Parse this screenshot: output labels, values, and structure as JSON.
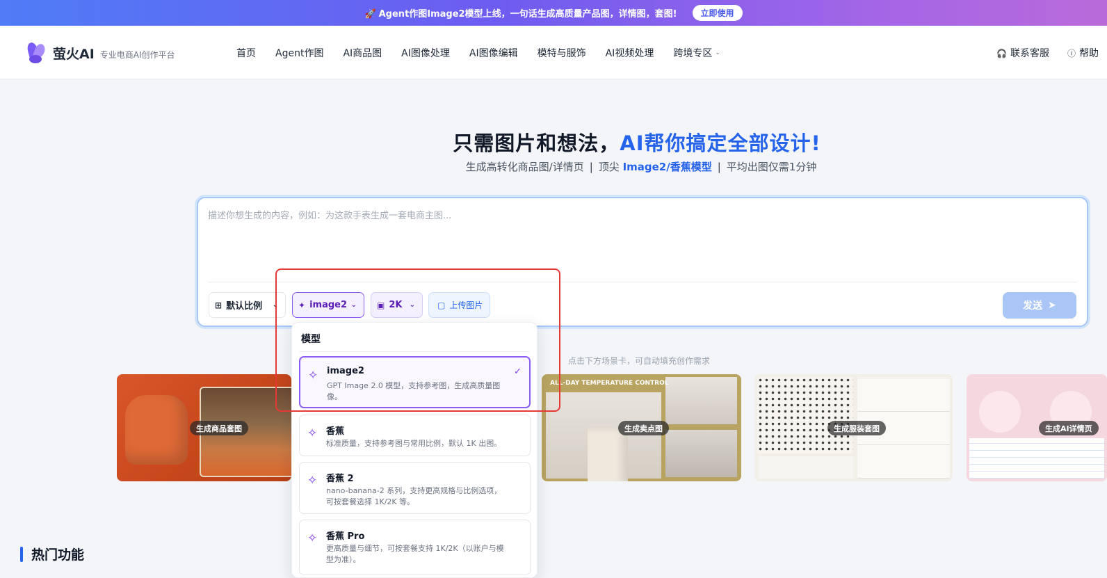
{
  "banner": {
    "icon": "rocket-icon",
    "text": "Agent作图Image2模型上线，一句话生成高质量产品图，详情图，套图!",
    "button": "立即使用"
  },
  "header": {
    "brand": "萤火AI",
    "brand_sub": "专业电商AI创作平台",
    "nav": [
      "首页",
      "Agent作图",
      "AI商品图",
      "AI图像处理",
      "AI图像编辑",
      "模特与服饰",
      "AI视频处理",
      "跨境专区"
    ],
    "support": "联系客服",
    "help": "帮助"
  },
  "hero": {
    "title_main": "只需图片和想法，",
    "title_accent": "AI帮你搞定全部设计!",
    "sub_part1": "生成高转化商品图/详情页",
    "sub_part2": "顶尖",
    "sub_accent": "Image2/香蕉模型",
    "sub_part3": "平均出图仅需1分钟",
    "separator": "|"
  },
  "prompt": {
    "placeholder": "描述你想生成的内容，例如：为这款手表生成一套电商主图...",
    "ratio": "默认比例",
    "model": "image2",
    "resolution": "2K",
    "upload": "上传图片",
    "send": "发送"
  },
  "hint": "点击下方场景卡，可自动填充创作需求",
  "cards": [
    {
      "label": "生成商品套图"
    },
    {
      "label": "生成卖点图",
      "header": "ALL-DAY TEMPERATURE CONTROL"
    },
    {
      "label": "生成服装套图"
    },
    {
      "label": "生成AI详情页"
    }
  ],
  "section": {
    "title": "热门功能"
  },
  "dropdown": {
    "title": "模型",
    "options": [
      {
        "name": "image2",
        "desc": "GPT Image 2.0 模型，支持参考图，生成高质量图像。",
        "selected": true
      },
      {
        "name": "香蕉",
        "desc": "标准质量，支持参考图与常用比例，默认 1K 出图。",
        "selected": false
      },
      {
        "name": "香蕉 2",
        "desc": "nano-banana-2 系列，支持更高规格与比例选项，可按套餐选择 1K/2K 等。",
        "selected": false
      },
      {
        "name": "香蕉 Pro",
        "desc": "更高质量与细节，可按套餐支持 1K/2K（以账户与模型为准）。",
        "selected": false
      }
    ]
  },
  "colors": {
    "accent": "#2563eb",
    "model_purple": "#8b5cf6",
    "annotation_red": "#e53935"
  }
}
